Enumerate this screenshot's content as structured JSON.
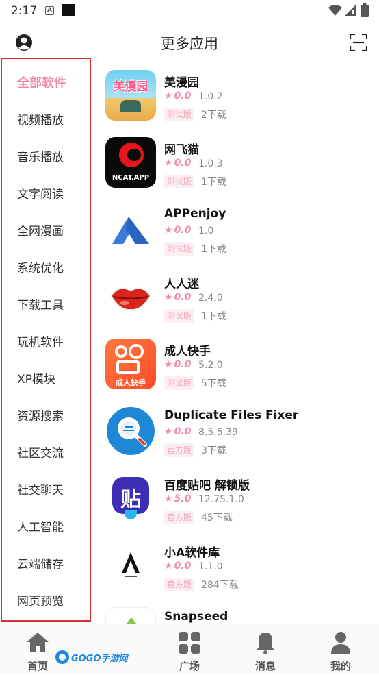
{
  "status_bar": {
    "time": "2:17",
    "a_icon": "A"
  },
  "header": {
    "title": "更多应用"
  },
  "sidebar": {
    "items": [
      {
        "label": "全部软件",
        "active": true
      },
      {
        "label": "视频播放"
      },
      {
        "label": "音乐播放"
      },
      {
        "label": "文字阅读"
      },
      {
        "label": "全网漫画"
      },
      {
        "label": "系统优化"
      },
      {
        "label": "下载工具"
      },
      {
        "label": "玩机软件"
      },
      {
        "label": "XP模块"
      },
      {
        "label": "资源搜索"
      },
      {
        "label": "社区交流"
      },
      {
        "label": "社交聊天"
      },
      {
        "label": "人工智能"
      },
      {
        "label": "云端储存"
      },
      {
        "label": "网页预览"
      }
    ]
  },
  "apps": [
    {
      "name": "美漫园",
      "rating": "0.0",
      "version": "1.0.2",
      "badge": "测试版",
      "downloads": "2下载",
      "icon": "meimanyuan-icon",
      "icon_text": "美漫园"
    },
    {
      "name": "网飞猫",
      "rating": "0.0",
      "version": "1.0.3",
      "badge": "测试版",
      "downloads": "1下载",
      "icon": "ncat-icon",
      "icon_text": "NCAT.APP"
    },
    {
      "name": "APPenjoy",
      "rating": "0.0",
      "version": "1.0",
      "badge": "测试版",
      "downloads": "1下载",
      "icon": "appenjoy-icon"
    },
    {
      "name": "人人迷",
      "rating": "0.0",
      "version": "2.4.0",
      "badge": "测试版",
      "downloads": "1下载",
      "icon": "lips-icon"
    },
    {
      "name": "成人快手",
      "rating": "0.0",
      "version": "5.2.0",
      "badge": "测试版",
      "downloads": "5下载",
      "icon": "kuaishou-icon",
      "icon_text": "成人快手"
    },
    {
      "name": "Duplicate Files Fixer",
      "rating": "0.0",
      "version": "8.5.5.39",
      "badge": "官方版",
      "downloads": "3下载",
      "icon": "duplicate-files-icon"
    },
    {
      "name": "百度贴吧 解锁版",
      "rating": "5.0",
      "version": "12.75.1.0",
      "badge": "官方版",
      "downloads": "45下载",
      "icon": "tieba-icon",
      "icon_text": "贴"
    },
    {
      "name": "小A软件库",
      "rating": "0.0",
      "version": "1.1.0",
      "badge": "官方版",
      "downloads": "284下载",
      "icon": "xiaoa-icon"
    },
    {
      "name": "Snapseed",
      "icon": "snapseed-icon"
    }
  ],
  "tabbar": {
    "items": [
      {
        "label": "首页",
        "icon": "home-icon"
      },
      {
        "label": "广场",
        "icon": "grid-icon"
      },
      {
        "label": "消息",
        "icon": "bell-icon"
      },
      {
        "label": "我的",
        "icon": "user-icon"
      }
    ]
  },
  "watermark": {
    "text": "GOGO手游网"
  },
  "colors": {
    "accent": "#f48aa5",
    "sidebar_border": "#d32f2f"
  }
}
